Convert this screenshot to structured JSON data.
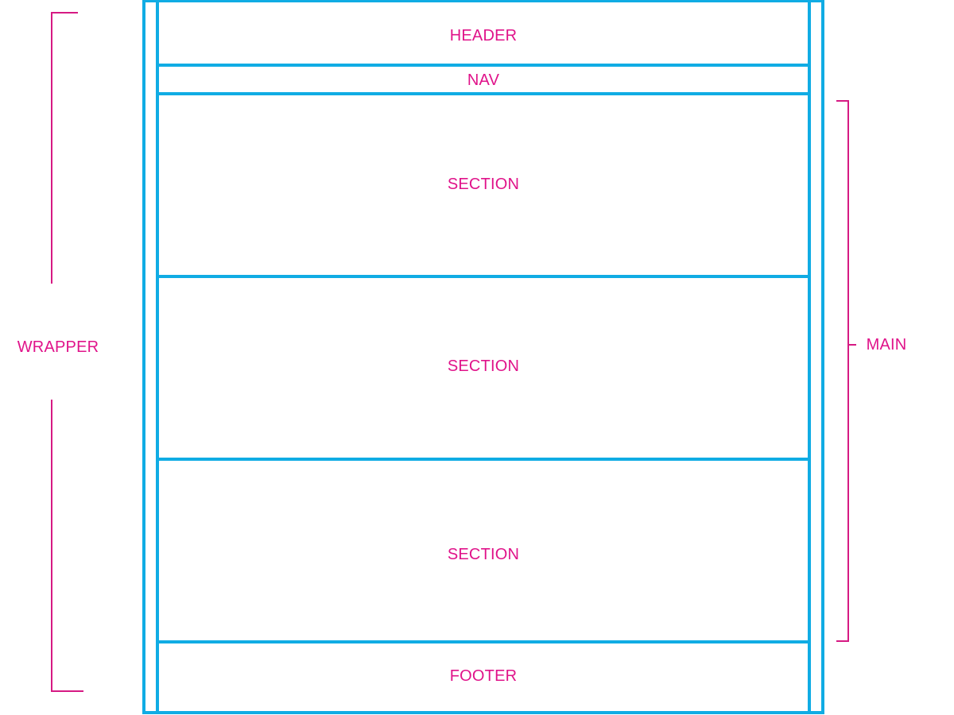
{
  "colors": {
    "box_stroke": "#10ACE4",
    "label_text": "#E0138A",
    "bracket_stroke": "#D61A83"
  },
  "labels": {
    "header": "HEADER",
    "nav": "NAV",
    "section_1": "SECTION",
    "section_2": "SECTION",
    "section_3": "SECTION",
    "footer": "FOOTER",
    "wrapper": "WRAPPER",
    "main": "MAIN"
  }
}
